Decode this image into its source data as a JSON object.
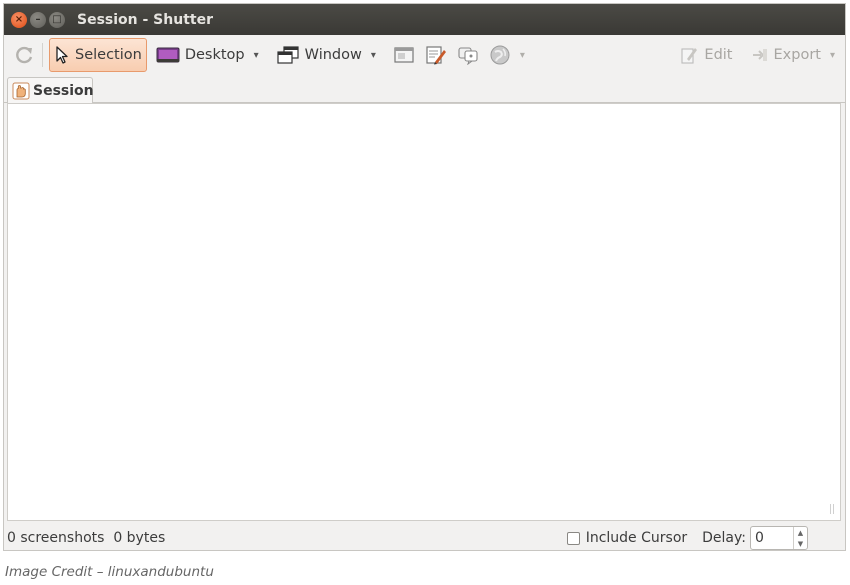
{
  "window": {
    "title": "Session - Shutter",
    "controls": {
      "close": "×",
      "minimize": "–",
      "maximize": "□"
    }
  },
  "toolbar": {
    "refresh_icon": "refresh-icon",
    "selection_label": "Selection",
    "desktop_label": "Desktop",
    "window_label": "Window",
    "dropdown_arrow": "▾",
    "edit_label": "Edit",
    "export_label": "Export",
    "accent": "#e89a6c"
  },
  "tabs": [
    {
      "label": "Session"
    }
  ],
  "statusbar": {
    "summary": "0 screenshots  0 bytes",
    "include_cursor_label": "Include Cursor",
    "include_cursor_checked": false,
    "delay_label": "Delay:",
    "delay_value": "0"
  },
  "caption": "Image Credit – linuxandubuntu"
}
